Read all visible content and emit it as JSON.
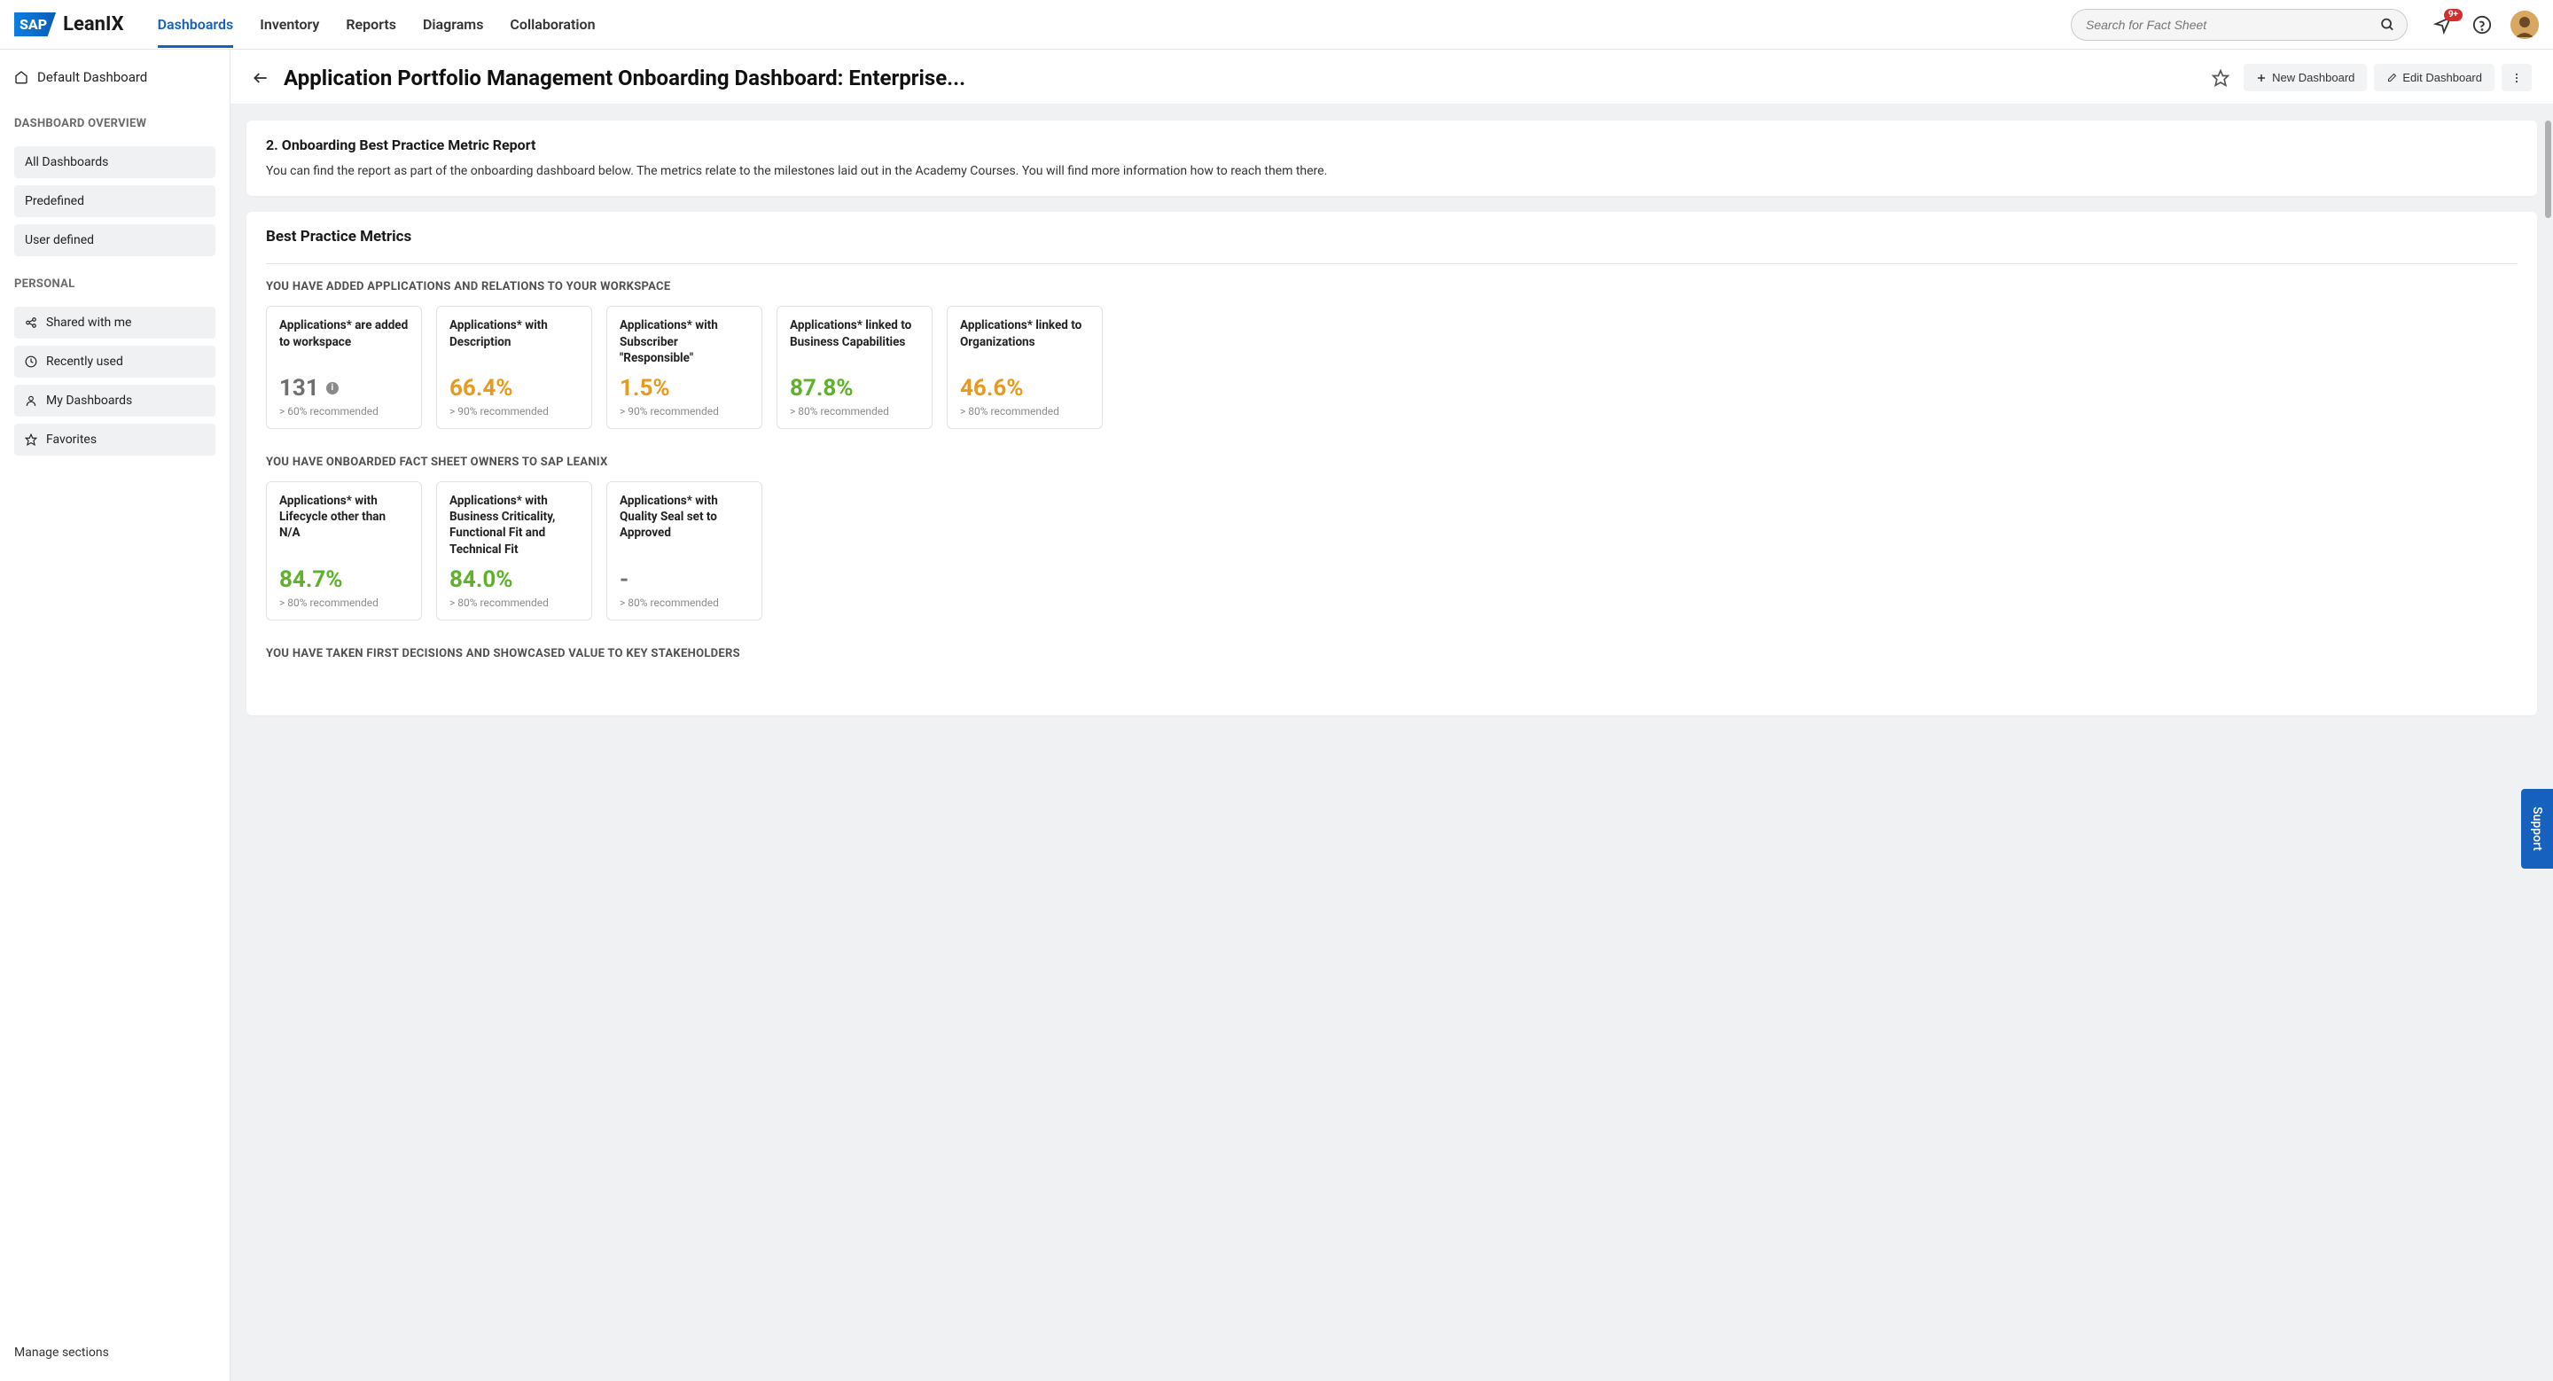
{
  "brand": {
    "sap": "SAP",
    "lean": "LeanIX"
  },
  "nav": {
    "items": [
      "Dashboards",
      "Inventory",
      "Reports",
      "Diagrams",
      "Collaboration"
    ],
    "active": 0
  },
  "search": {
    "placeholder": "Search for Fact Sheet"
  },
  "notifications": {
    "badge": "9+"
  },
  "sidebar": {
    "default_link": "Default Dashboard",
    "overview_label": "DASHBOARD OVERVIEW",
    "overview_items": [
      "All Dashboards",
      "Predefined",
      "User defined"
    ],
    "personal_label": "PERSONAL",
    "personal_items": [
      {
        "icon": "share",
        "label": "Shared with me"
      },
      {
        "icon": "clock",
        "label": "Recently used"
      },
      {
        "icon": "user",
        "label": "My Dashboards"
      },
      {
        "icon": "star",
        "label": "Favorites"
      }
    ],
    "footer": "Manage sections"
  },
  "header": {
    "title": "Application Portfolio Management Onboarding Dashboard: Enterprise...",
    "new_btn": "New Dashboard",
    "edit_btn": "Edit Dashboard"
  },
  "intro": {
    "title": "2. Onboarding Best Practice Metric Report",
    "body": "You can find the report as part of the onboarding dashboard below. The metrics relate to the milestones laid out in the Academy Courses. You will find more information how to reach them there."
  },
  "metrics": {
    "heading": "Best Practice Metrics",
    "sections": [
      {
        "label": "YOU HAVE ADDED APPLICATIONS AND RELATIONS TO YOUR WORKSPACE",
        "tiles": [
          {
            "title": "Applications* are added to workspace",
            "value": "131",
            "color": "gray",
            "info": true,
            "sub": "> 60% recommended"
          },
          {
            "title": "Applications* with Description",
            "value": "66.4%",
            "color": "orange",
            "sub": "> 90% recommended"
          },
          {
            "title": "Applications* with Subscriber \"Responsible\"",
            "value": "1.5%",
            "color": "orange",
            "sub": "> 90% recommended"
          },
          {
            "title": "Applications* linked to Business Capabilities",
            "value": "87.8%",
            "color": "green",
            "sub": "> 80% recommended"
          },
          {
            "title": "Applications* linked to Organizations",
            "value": "46.6%",
            "color": "orange",
            "sub": "> 80% recommended"
          }
        ]
      },
      {
        "label": "YOU HAVE ONBOARDED FACT SHEET OWNERS TO SAP LEANIX",
        "tiles": [
          {
            "title": "Applications* with Lifecycle other than N/A",
            "value": "84.7%",
            "color": "green",
            "sub": "> 80% recommended"
          },
          {
            "title": "Applications* with Business Criticality, Functional Fit and Technical Fit",
            "value": "84.0%",
            "color": "green",
            "sub": "> 80% recommended"
          },
          {
            "title": "Applications* with Quality Seal set to Approved",
            "value": "-",
            "color": "gray",
            "sub": "> 80% recommended"
          }
        ]
      },
      {
        "label": "YOU HAVE TAKEN FIRST DECISIONS AND SHOWCASED VALUE TO KEY STAKEHOLDERS",
        "tiles": []
      }
    ]
  },
  "support": "Support"
}
